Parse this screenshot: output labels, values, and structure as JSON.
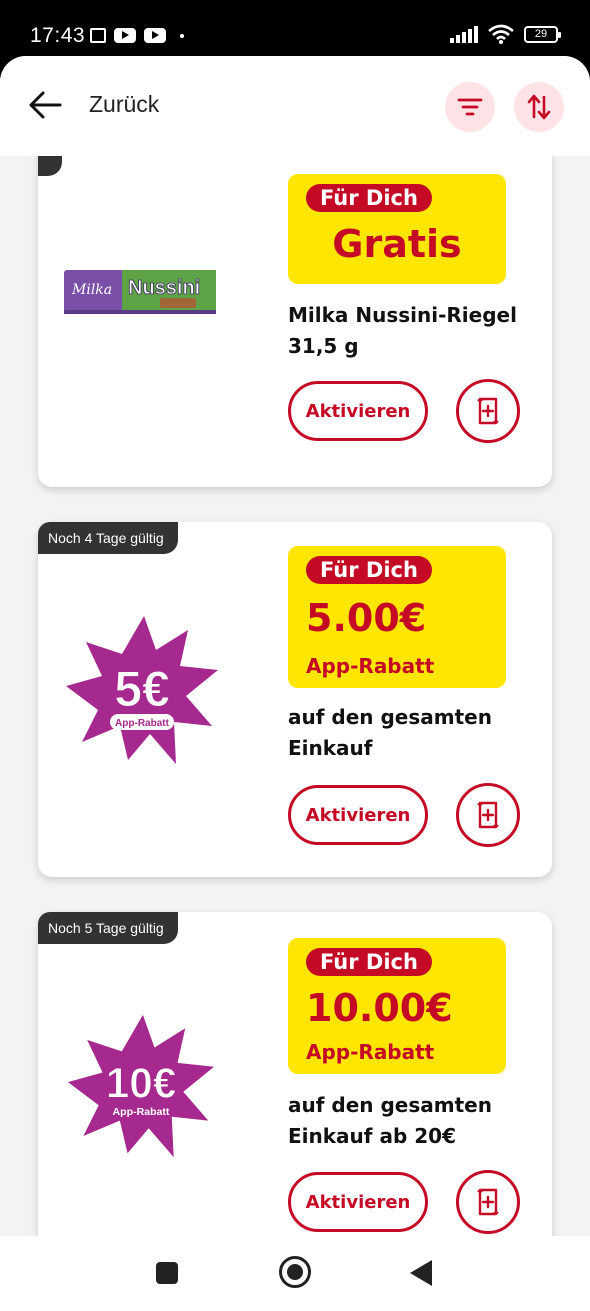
{
  "status_bar": {
    "time": "17:43",
    "battery": "29"
  },
  "header": {
    "back_label": "Zurück"
  },
  "offers": [
    {
      "validity": "",
      "badge": "Für Dich",
      "value": "Gratis",
      "sub": "",
      "description_line1": "Milka Nussini-Riegel",
      "description_line2": "31,5 g",
      "activate_label": "Aktivieren",
      "product_brand": "Milka",
      "product_name": "Nussini",
      "image": "chocolate-bar"
    },
    {
      "validity": "Noch 4 Tage gültig",
      "badge": "Für Dich",
      "value": "5.00€",
      "sub": "App-Rabatt",
      "description_line1": "auf den gesamten",
      "description_line2": "Einkauf",
      "activate_label": "Aktivieren",
      "burst_value": "5€",
      "burst_label": "App-Rabatt",
      "image": "discount-burst"
    },
    {
      "validity": "Noch 5 Tage gültig",
      "badge": "Für Dich",
      "value": "10.00€",
      "sub": "App-Rabatt",
      "description_line1": "auf den gesamten",
      "description_line2": "Einkauf ab 20€",
      "activate_label": "Aktivieren",
      "burst_value": "10€",
      "burst_label": "App-Rabatt",
      "image": "discount-burst"
    }
  ],
  "colors": {
    "brand_red": "#c50a25",
    "badge_yellow": "#ffe600",
    "burst_purple": "#a6298f",
    "validity_bg": "#333333"
  }
}
